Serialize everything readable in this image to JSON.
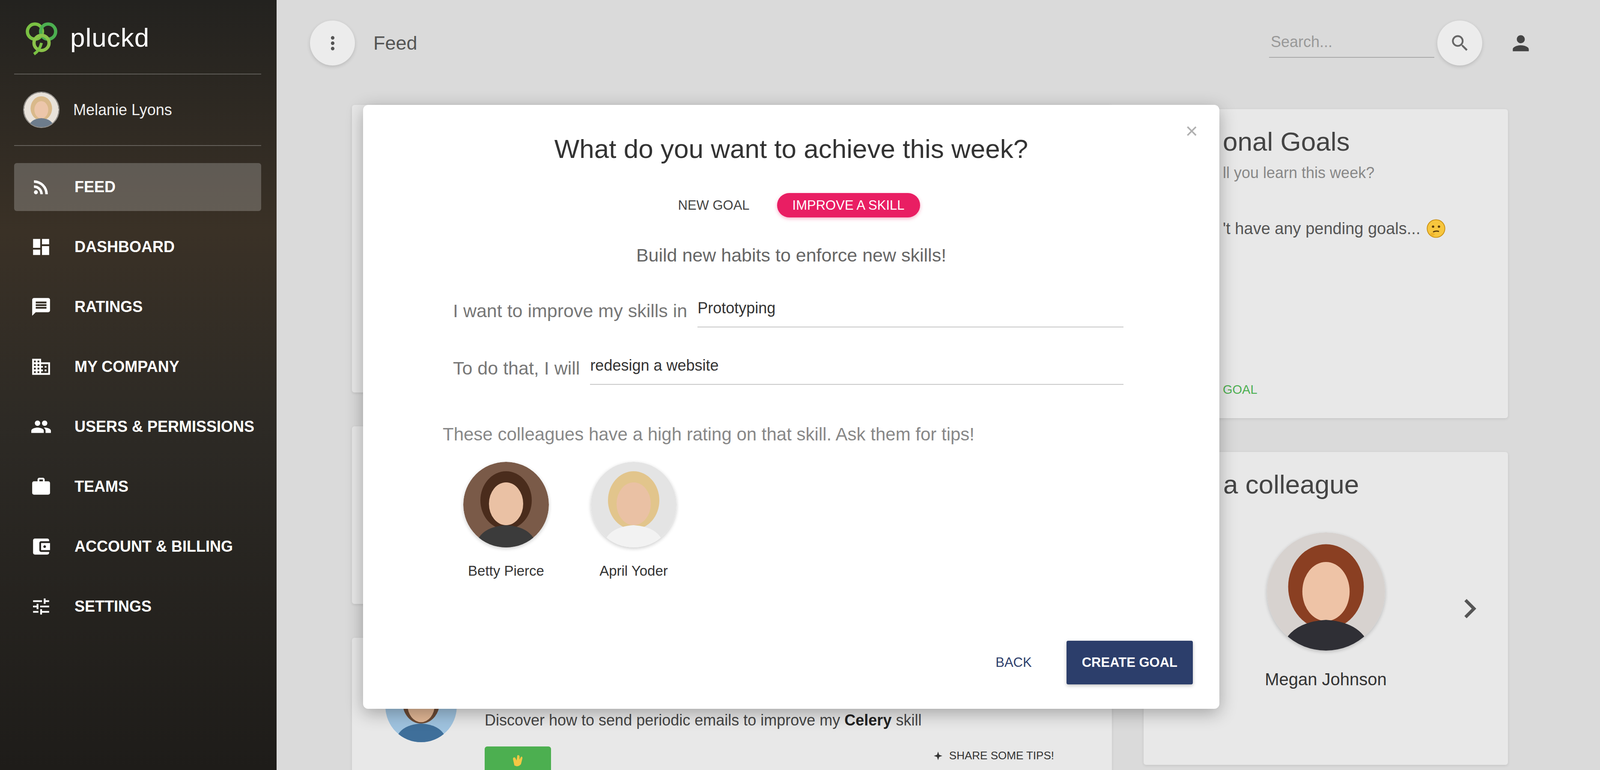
{
  "app": {
    "logo": "pluckd"
  },
  "user": {
    "name": "Melanie Lyons"
  },
  "sidebar": {
    "items": [
      {
        "label": "FEED",
        "selected": true
      },
      {
        "label": "DASHBOARD",
        "selected": false
      },
      {
        "label": "RATINGS",
        "selected": false
      },
      {
        "label": "MY COMPANY",
        "selected": false
      },
      {
        "label": "USERS & PERMISSIONS",
        "selected": false
      },
      {
        "label": "TEAMS",
        "selected": false
      },
      {
        "label": "ACCOUNT & BILLING",
        "selected": false
      },
      {
        "label": "SETTINGS",
        "selected": false
      }
    ]
  },
  "topbar": {
    "title": "Feed",
    "search": {
      "placeholder": "Search..."
    }
  },
  "background": {
    "goals_card": {
      "title": "onal Goals",
      "subtitle": "ll you learn this week?",
      "empty": "'t have any pending goals...",
      "link": "GOAL"
    },
    "colleague_card": {
      "title": "a colleague",
      "name": "Megan Johnson"
    },
    "post": {
      "text": "Discover how to send periodic emails to improve my ",
      "skill": "Celery",
      "suffix": " skill",
      "share": "SHARE SOME TIPS!"
    }
  },
  "modal": {
    "title": "What do you want to achieve this week?",
    "close": "×",
    "tabs": [
      {
        "label": "NEW GOAL",
        "selected": false
      },
      {
        "label": "IMPROVE A SKILL",
        "selected": true
      }
    ],
    "subtitle": "Build new habits to enforce new skills!",
    "fields": [
      {
        "label": "I want to improve my skills in",
        "value": "Prototyping"
      },
      {
        "label": "To do that, I will",
        "value": "redesign a website"
      }
    ],
    "hint": "These colleagues have a high rating on that skill. Ask them for tips!",
    "colleagues": [
      {
        "name": "Betty Pierce"
      },
      {
        "name": "April Yoder"
      }
    ],
    "buttons": [
      {
        "label": "BACK",
        "kind": "flat"
      },
      {
        "label": "CREATE GOAL",
        "kind": "raised"
      }
    ]
  }
}
